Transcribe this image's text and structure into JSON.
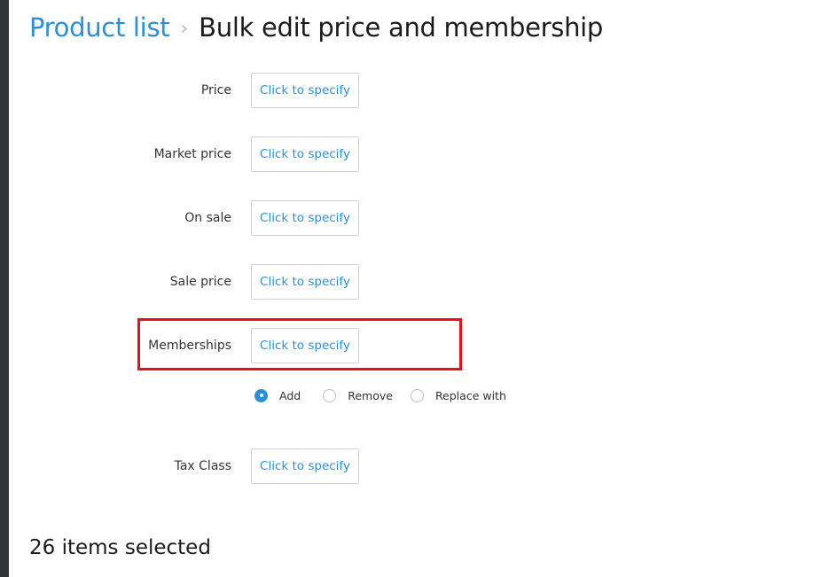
{
  "breadcrumb": {
    "parent": "Product list",
    "separator": "›",
    "title": "Bulk edit price and membership"
  },
  "fields": [
    {
      "label": "Price",
      "button_label": "Click to specify"
    },
    {
      "label": "Market price",
      "button_label": "Click to specify"
    },
    {
      "label": "On sale",
      "button_label": "Click to specify"
    },
    {
      "label": "Sale price",
      "button_label": "Click to specify"
    },
    {
      "label": "Memberships",
      "button_label": "Click to specify"
    },
    {
      "label": "Tax Class",
      "button_label": "Click to specify"
    }
  ],
  "membership_mode": {
    "options": [
      "Add",
      "Remove",
      "Replace with"
    ],
    "selected": "Add"
  },
  "footer": {
    "selection_count": "26 items selected"
  },
  "colors": {
    "accent": "#2d8fd5",
    "highlight_border": "#e4121b",
    "sidebar": "#2e3438"
  }
}
